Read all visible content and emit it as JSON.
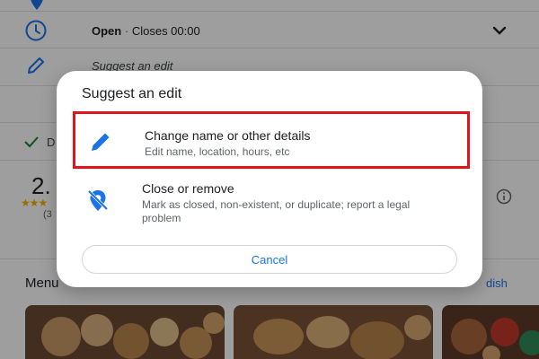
{
  "background": {
    "hours": {
      "status": "Open",
      "separator": "·",
      "closes": "Closes 00:00"
    },
    "suggest_row": {
      "label": "Suggest an edit"
    },
    "check_row": {
      "label": "D"
    },
    "rating": {
      "value": "2.",
      "stars": "★★★",
      "count": "(3"
    },
    "menu": {
      "heading": "Menu",
      "link": "dish"
    }
  },
  "dialog": {
    "title": "Suggest an edit",
    "options": [
      {
        "title": "Change name or other details",
        "subtitle": "Edit name, location, hours, etc",
        "icon": "pencil-icon"
      },
      {
        "title": "Close or remove",
        "subtitle": "Mark as closed, non-existent, or duplicate; report a legal problem",
        "icon": "location-off-icon"
      }
    ],
    "cancel_label": "Cancel"
  },
  "colors": {
    "accent": "#1a73e8",
    "highlight": "#e0151c",
    "stars": "#f4b400"
  }
}
